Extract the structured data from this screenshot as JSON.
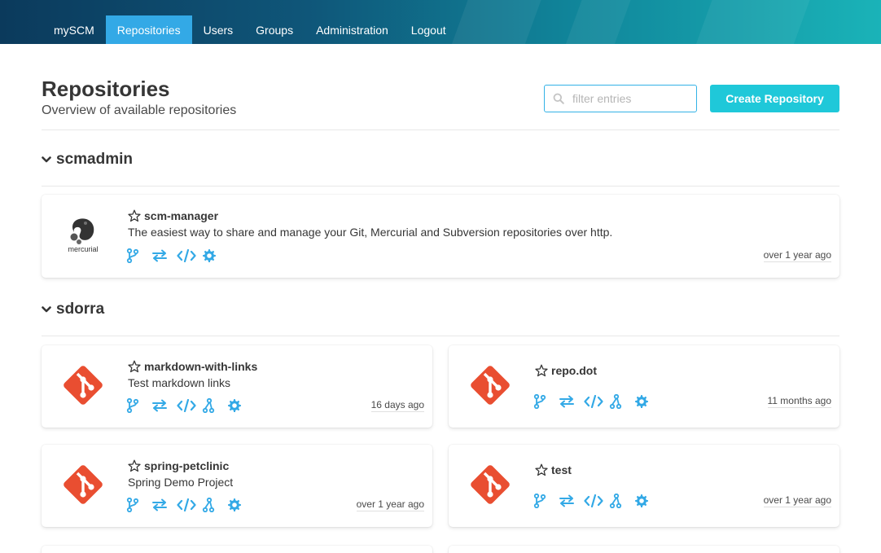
{
  "nav": {
    "items": [
      {
        "label": "mySCM",
        "active": false
      },
      {
        "label": "Repositories",
        "active": true
      },
      {
        "label": "Users",
        "active": false
      },
      {
        "label": "Groups",
        "active": false
      },
      {
        "label": "Administration",
        "active": false
      },
      {
        "label": "Logout",
        "active": false
      }
    ]
  },
  "header": {
    "title": "Repositories",
    "subtitle": "Overview of available repositories",
    "search_placeholder": "filter entries",
    "search_value": "",
    "create_label": "Create Repository"
  },
  "colors": {
    "accent": "#33a9e6",
    "primary_button": "#1fc8d9",
    "git_logo": "#e94e31",
    "action_icon": "#33a9e6"
  },
  "groups": [
    {
      "name": "scmadmin",
      "repos": [
        {
          "name": "scm-manager",
          "description": "The easiest way to share and manage your Git, Mercurial and Subversion repositories over http.",
          "date": "over 1 year ago",
          "type": "mercurial",
          "logo_text": "mercurial",
          "actions": [
            "branches-icon",
            "changesets-icon",
            "sources-icon",
            "settings-icon"
          ]
        }
      ]
    },
    {
      "name": "sdorra",
      "repos": [
        {
          "name": "markdown-with-links",
          "description": "Test markdown links",
          "date": "16 days ago",
          "type": "git",
          "actions": [
            "branches-icon",
            "changesets-icon",
            "sources-icon",
            "pull-request-icon",
            "settings-icon"
          ]
        },
        {
          "name": "repo.dot",
          "description": "",
          "date": "11 months ago",
          "type": "git",
          "actions": [
            "branches-icon",
            "changesets-icon",
            "sources-icon",
            "pull-request-icon",
            "settings-icon"
          ]
        },
        {
          "name": "spring-petclinic",
          "description": "Spring Demo Project",
          "date": "over 1 year ago",
          "type": "git",
          "actions": [
            "branches-icon",
            "changesets-icon",
            "sources-icon",
            "pull-request-icon",
            "settings-icon"
          ]
        },
        {
          "name": "test",
          "description": "",
          "date": "over 1 year ago",
          "type": "git",
          "actions": [
            "branches-icon",
            "changesets-icon",
            "sources-icon",
            "pull-request-icon",
            "settings-icon"
          ]
        }
      ]
    }
  ]
}
